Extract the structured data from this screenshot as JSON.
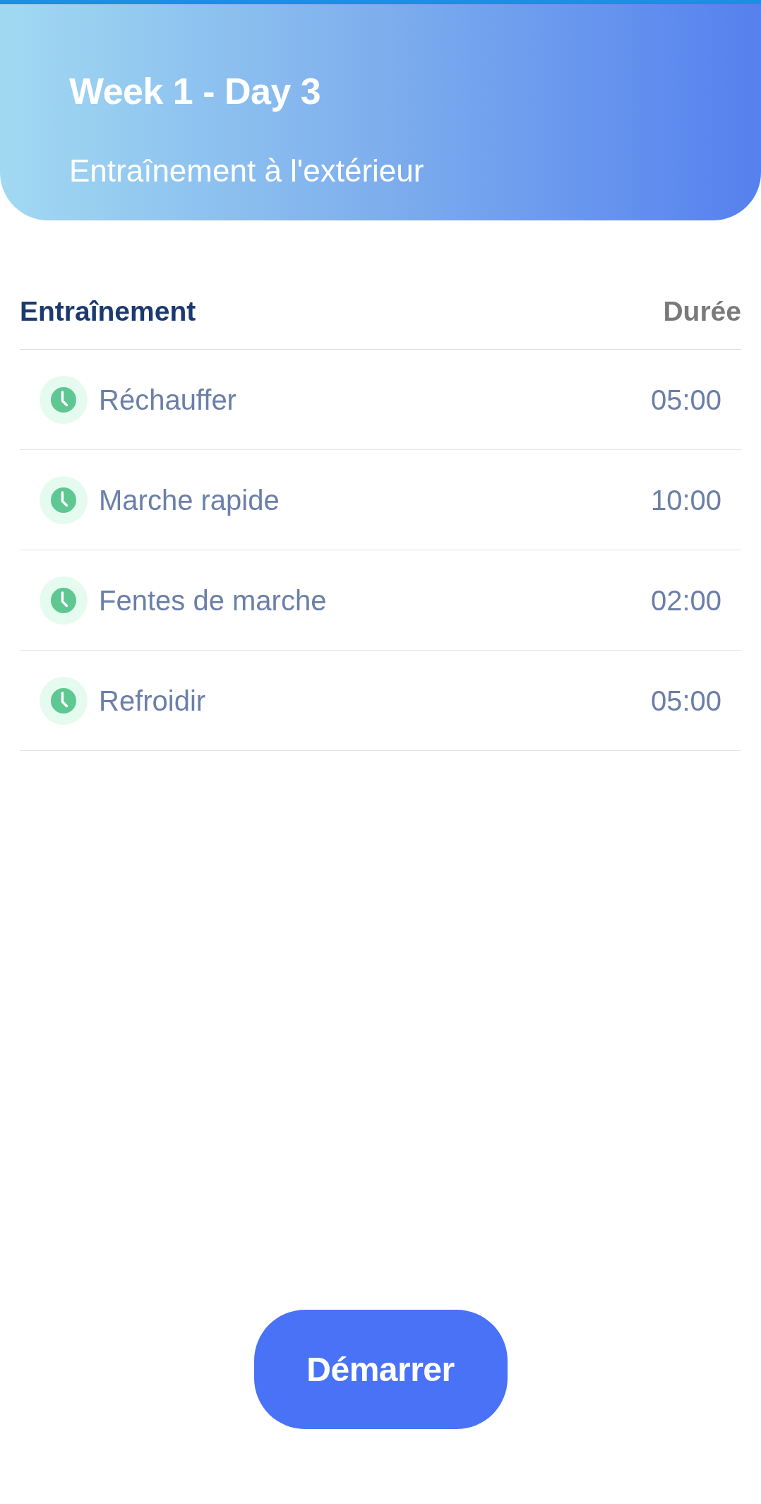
{
  "header": {
    "title": "Week 1 - Day 3",
    "subtitle": "Entraînement à l'extérieur"
  },
  "table": {
    "columns": [
      "Entraînement",
      "Durée"
    ],
    "rows": [
      {
        "name": "Réchauffer",
        "duration": "05:00"
      },
      {
        "name": "Marche rapide",
        "duration": "10:00"
      },
      {
        "name": "Fentes de marche",
        "duration": "02:00"
      },
      {
        "name": "Refroidir",
        "duration": "05:00"
      }
    ]
  },
  "start_button": {
    "label": "Démarrer"
  }
}
